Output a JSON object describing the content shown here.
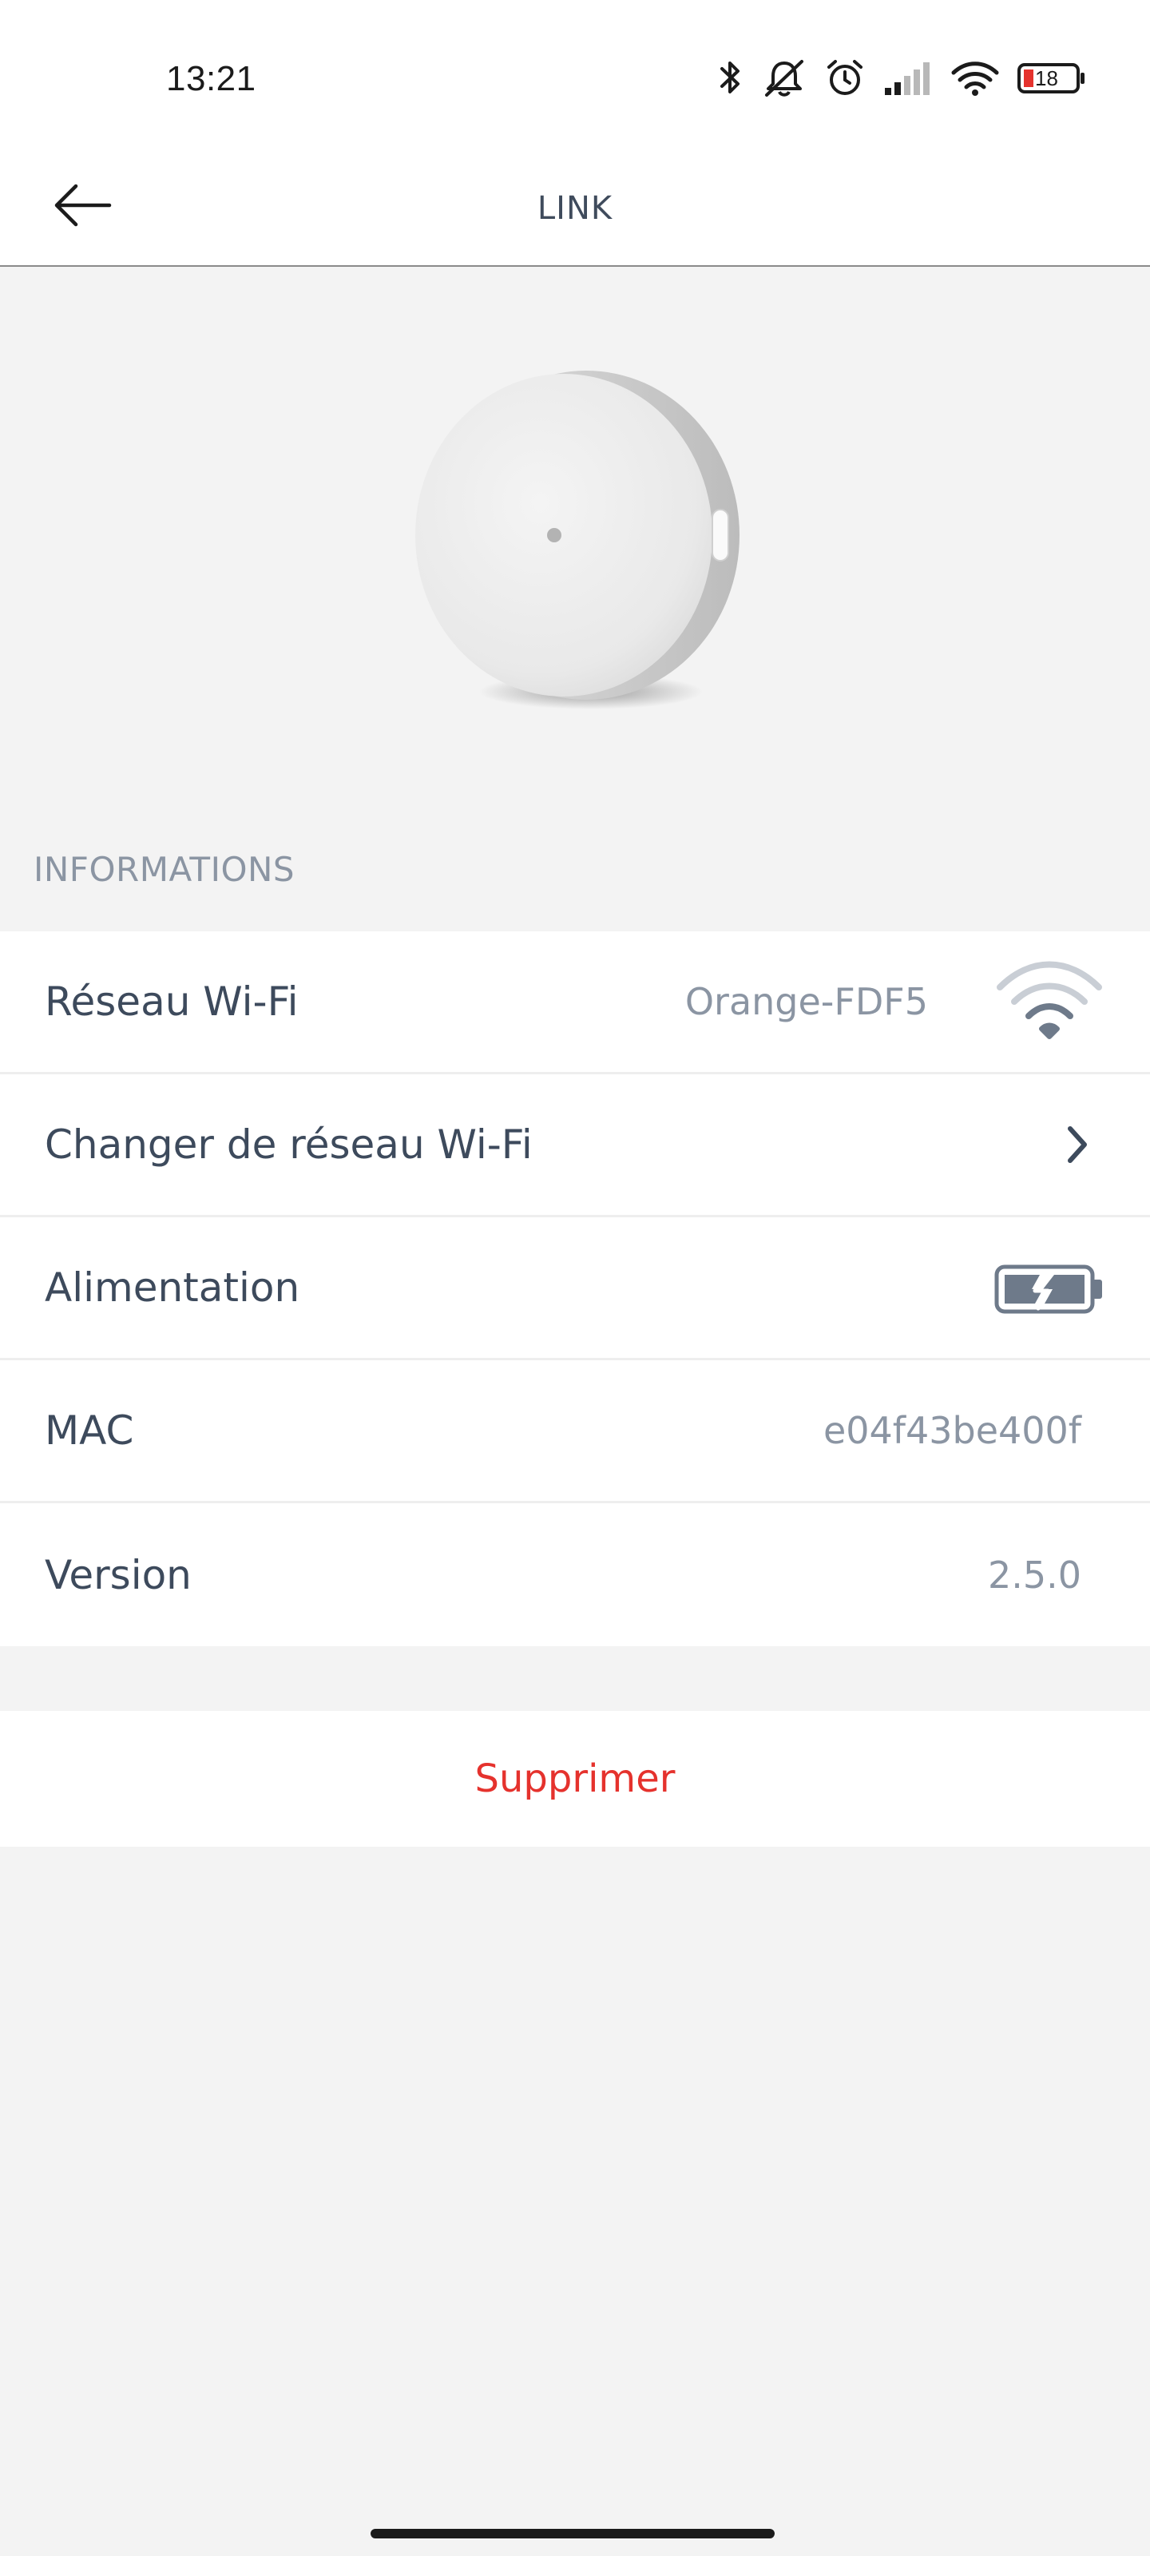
{
  "status_bar": {
    "time": "13:21",
    "battery_level": "18",
    "icons": [
      "bluetooth-icon",
      "muted-bell-icon",
      "alarm-icon",
      "signal-icon",
      "wifi-icon",
      "battery-icon"
    ]
  },
  "header": {
    "title": "LINK",
    "back_icon": "arrow-left-icon"
  },
  "device": {
    "image": "round-white-device-image"
  },
  "informations": {
    "section_title": "INFORMATIONS",
    "rows": [
      {
        "label": "Réseau Wi-Fi",
        "value": "Orange-FDF5",
        "icon": "wifi-strength-icon"
      },
      {
        "label": "Changer de réseau Wi-Fi",
        "icon": "chevron-right-icon"
      },
      {
        "label": "Alimentation",
        "icon": "battery-charging-icon"
      },
      {
        "label": "MAC",
        "value": "e04f43be400f"
      },
      {
        "label": "Version",
        "value": "2.5.0"
      }
    ]
  },
  "actions": {
    "delete_label": "Supprimer"
  },
  "colors": {
    "accent_delete": "#e5322d",
    "label_text": "#3d4a5c",
    "value_text": "#8b95a3",
    "background": "#f3f3f3"
  }
}
